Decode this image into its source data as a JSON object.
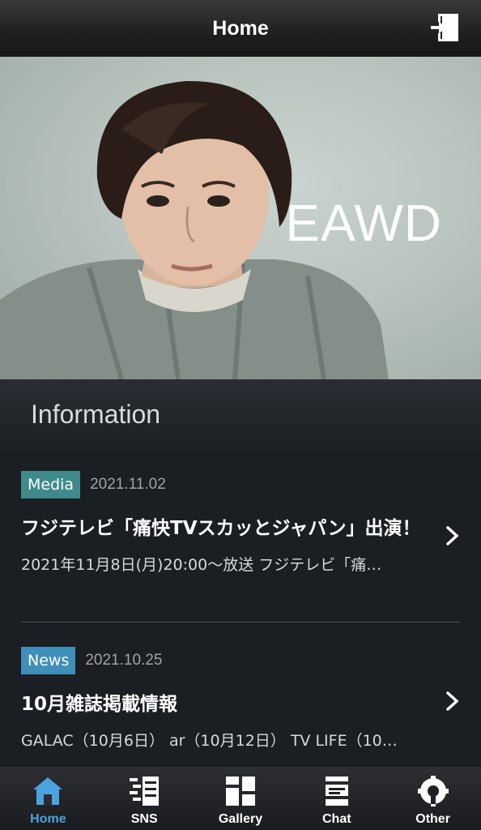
{
  "header": {
    "title": "Home",
    "logout_icon": "logout-icon"
  },
  "hero": {
    "brand_text": "EAWD"
  },
  "section": {
    "title": "Information"
  },
  "news": [
    {
      "category": "Media",
      "date": "2021.11.02",
      "headline": "フジテレビ「痛快TVスカッとジャパン」出演！",
      "excerpt": "2021年11月8日(月)20:00〜放送 フジテレビ「痛…"
    },
    {
      "category": "News",
      "date": "2021.10.25",
      "headline": "10月雑誌掲載情報",
      "excerpt": "GALAC（10月6日） ar（10月12日） TV LIFE（10…"
    }
  ],
  "tabs": [
    {
      "label": "Home",
      "icon": "home-icon",
      "active": true
    },
    {
      "label": "SNS",
      "icon": "sns-icon",
      "active": false
    },
    {
      "label": "Gallery",
      "icon": "gallery-icon",
      "active": false
    },
    {
      "label": "Chat",
      "icon": "chat-icon",
      "active": false
    },
    {
      "label": "Other",
      "icon": "other-icon",
      "active": false
    }
  ],
  "colors": {
    "accent": "#4aa3dd",
    "media_badge": "#3f8a8a",
    "news_badge": "#3f8fb8"
  }
}
